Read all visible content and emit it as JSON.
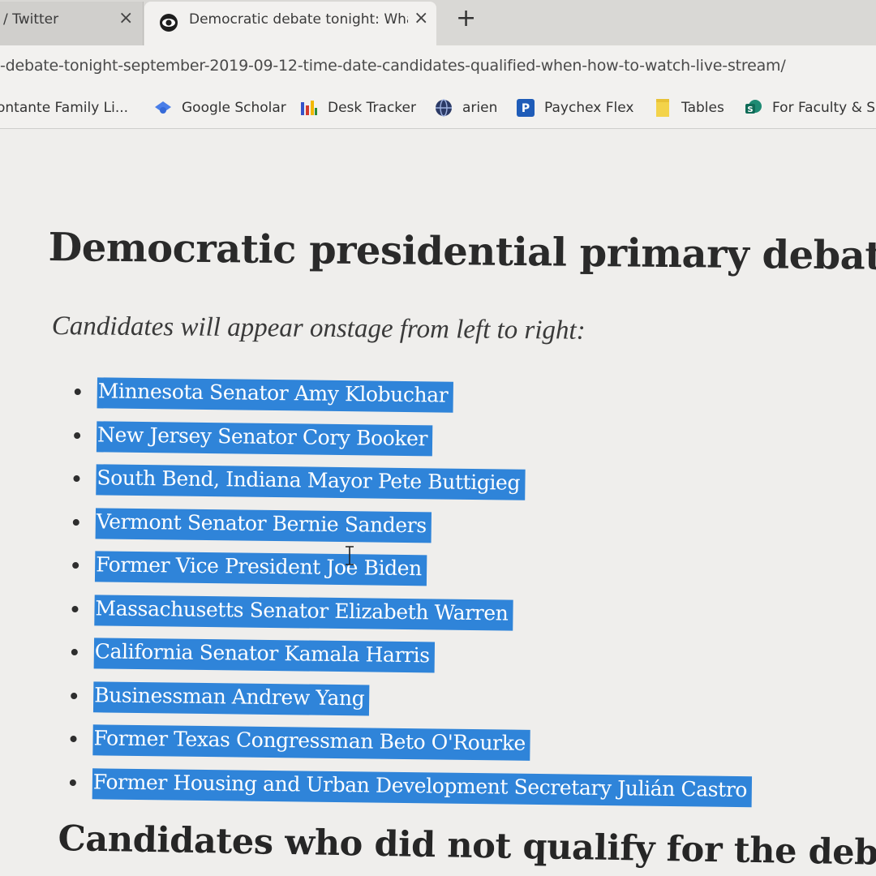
{
  "tabs": [
    {
      "title": "/ Twitter",
      "close": "×"
    },
    {
      "title": "Democratic debate tonight: Wha",
      "close": "×",
      "active": true
    }
  ],
  "new_tab_label": "+",
  "address_bar": {
    "url": "-debate-tonight-september-2019-09-12-time-date-candidates-qualified-when-how-to-watch-live-stream/"
  },
  "bookmarks": [
    {
      "label": "ontante Family Li...",
      "icon": "bookmark-icon"
    },
    {
      "label": "Google Scholar",
      "icon": "google-scholar-icon"
    },
    {
      "label": "Desk Tracker",
      "icon": "desk-tracker-icon"
    },
    {
      "label": "arien",
      "icon": "globe-icon"
    },
    {
      "label": "Paychex Flex",
      "icon": "paychex-icon",
      "icon_letter": "P"
    },
    {
      "label": "Tables",
      "icon": "folder-icon"
    },
    {
      "label": "For Faculty & S",
      "icon": "sharepoint-icon",
      "icon_letter": "S"
    }
  ],
  "article": {
    "heading": "Democratic presidential primary debate cand",
    "intro": "Candidates will appear onstage from left to right:",
    "candidates": [
      "Minnesota Senator Amy Klobuchar",
      "New Jersey Senator Cory Booker",
      "South Bend, Indiana Mayor Pete Buttigieg",
      "Vermont Senator Bernie Sanders",
      "Former Vice President Joe Biden",
      "Massachusetts Senator Elizabeth Warren",
      "California Senator Kamala Harris",
      "Businessman Andrew Yang",
      "Former Texas Congressman Beto O'Rourke",
      "Former Housing and Urban Development Secretary Julián Castro"
    ],
    "subheading": "Candidates who did not qualify for the debate"
  },
  "colors": {
    "selection": "#2f84d9",
    "tabstrip": "#d9d8d5",
    "page_background": "#efeeec"
  }
}
